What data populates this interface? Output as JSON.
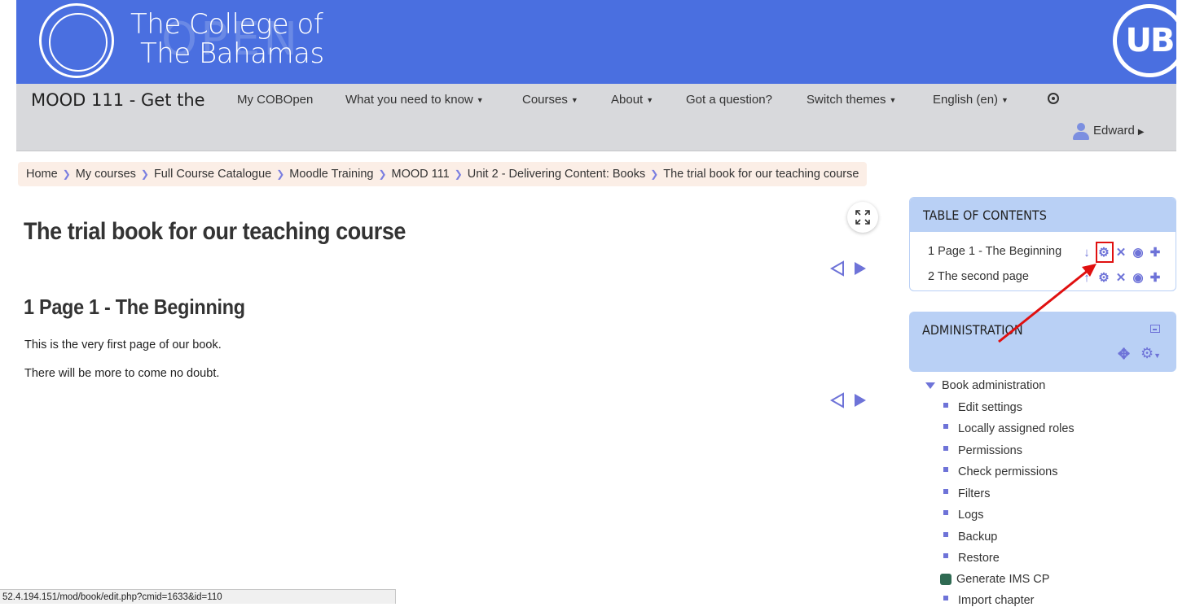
{
  "header": {
    "college_line1": "The College of",
    "college_line2": "The Bahamas",
    "watermark": "OPEN",
    "ub_logo": "UB",
    "icons": {
      "seal": "college-seal-logo",
      "ub": "ub-logo"
    }
  },
  "navbar": {
    "brand": "MOOD 111 - Get the",
    "menu": [
      {
        "label": "My COBOpen",
        "dropdown": false
      },
      {
        "label": "What you need to know",
        "dropdown": true
      },
      {
        "label": "Courses",
        "dropdown": true
      },
      {
        "label": "About",
        "dropdown": true
      },
      {
        "label": "Got a question?",
        "dropdown": false
      },
      {
        "label": "Switch themes",
        "dropdown": true
      },
      {
        "label": "English (en)",
        "dropdown": true
      }
    ],
    "accessibility_icon": "accessibility-icon",
    "user": "Edward"
  },
  "breadcrumb": [
    "Home",
    "My courses",
    "Full Course Catalogue",
    "Moodle Training",
    "MOOD 111",
    "Unit 2 - Delivering Content: Books",
    "The trial book for our teaching course"
  ],
  "main": {
    "page_title": "The trial book for our teaching course",
    "chapter_title": "1 Page 1 - The Beginning",
    "paragraphs": [
      "This is the very first page of our book.",
      "There will be more to come no doubt."
    ]
  },
  "toc": {
    "title": "TABLE OF CONTENTS",
    "items": [
      {
        "label": "1 Page 1 - The Beginning",
        "move_icon": "arrow-down-icon"
      },
      {
        "label": "2 The second page",
        "move_icon": "arrow-up-icon"
      }
    ]
  },
  "administration": {
    "title": "ADMINISTRATION",
    "root": "Book administration",
    "items": [
      "Edit settings",
      "Locally assigned roles",
      "Permissions",
      "Check permissions",
      "Filters",
      "Logs",
      "Backup",
      "Restore",
      "Generate IMS CP",
      "Import chapter"
    ]
  },
  "status_bar": "52.4.194.151/mod/book/edit.php?cmid=1633&id=110",
  "colors": {
    "header_blue": "#4a6fe0",
    "navbar_gray": "#d8d9dc",
    "accent_purple": "#6e73d8",
    "block_blue": "#b9d0f5",
    "annotation_red": "#e01010"
  }
}
